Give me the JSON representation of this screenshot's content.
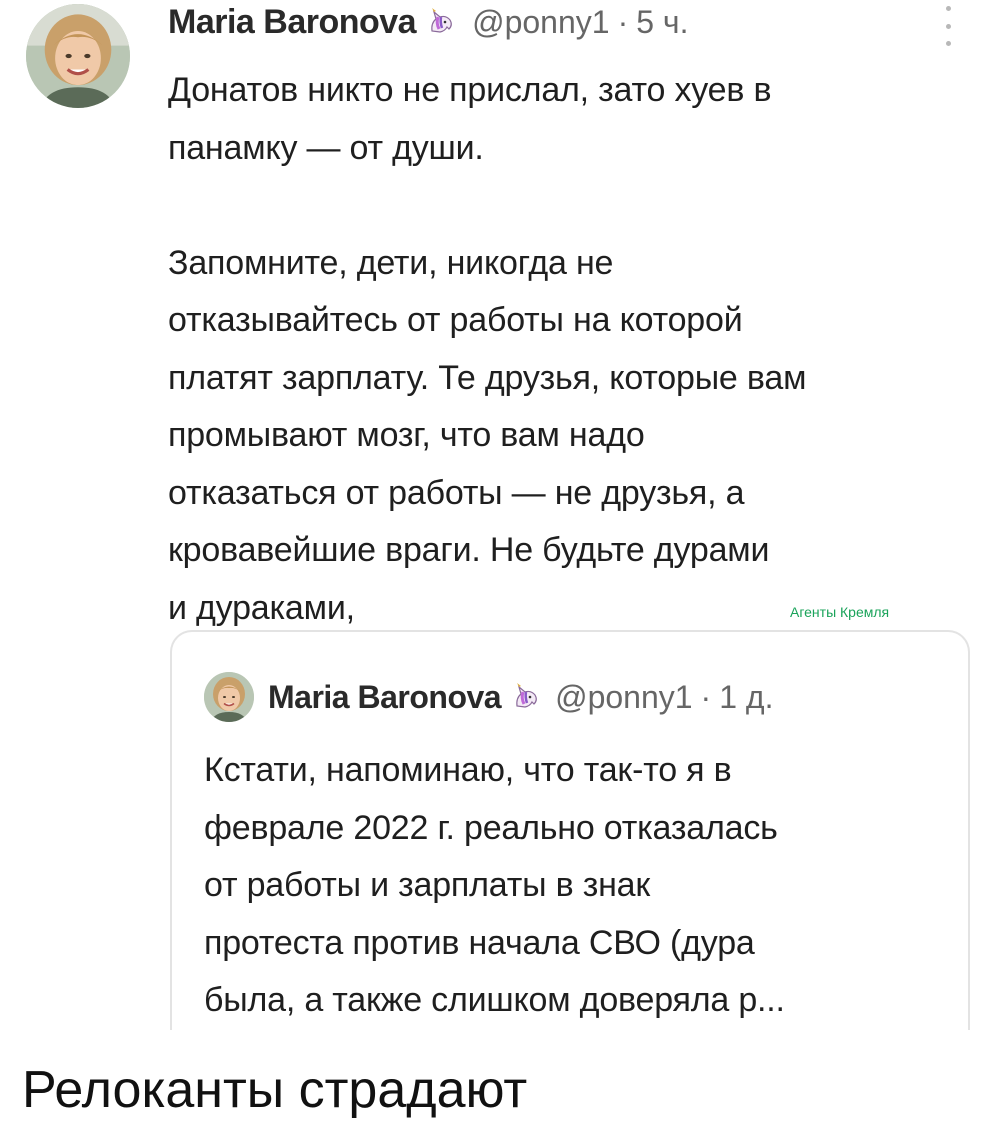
{
  "tweet": {
    "avatar_icon": "profile-photo",
    "author_name": "Maria Baronova",
    "badge_icon": "unicorn-emoji",
    "handle": "@ponny1",
    "dot": "·",
    "time": "5 ч.",
    "more_icon": "vertical-ellipsis",
    "text": "Донатов никто не прислал, зато хуев в\nпанамку — от души.\n\nЗапомните, дети, никогда не\nотказывайтесь от работы на которой\nплатят зарплату. Те друзья, которые вам\nпромывают мозг, что вам надо\nотказаться от работы — не друзья, а\nкровавейшие  враги. Не будьте дурами\nи дураками,"
  },
  "watermark": {
    "text": "Агенты Кремля",
    "color": "#1aa35a"
  },
  "quoted_tweet": {
    "avatar_icon": "profile-photo",
    "author_name": "Maria Baronova",
    "badge_icon": "unicorn-emoji",
    "handle": "@ponny1",
    "dot": "·",
    "time": "1 д.",
    "text": "Кстати, напоминаю, что так-то я в\nфеврале 2022 г. реально отказалась\nот работы и зарплаты в знак\nпротеста против начала СВО (дура\nбыла, а также слишком доверяла р..."
  },
  "caption": {
    "text": "Релоканты страдают"
  },
  "colors": {
    "text": "#1f1f1f",
    "muted": "#666666",
    "card_border": "#e3e3e3",
    "background": "#ffffff"
  }
}
